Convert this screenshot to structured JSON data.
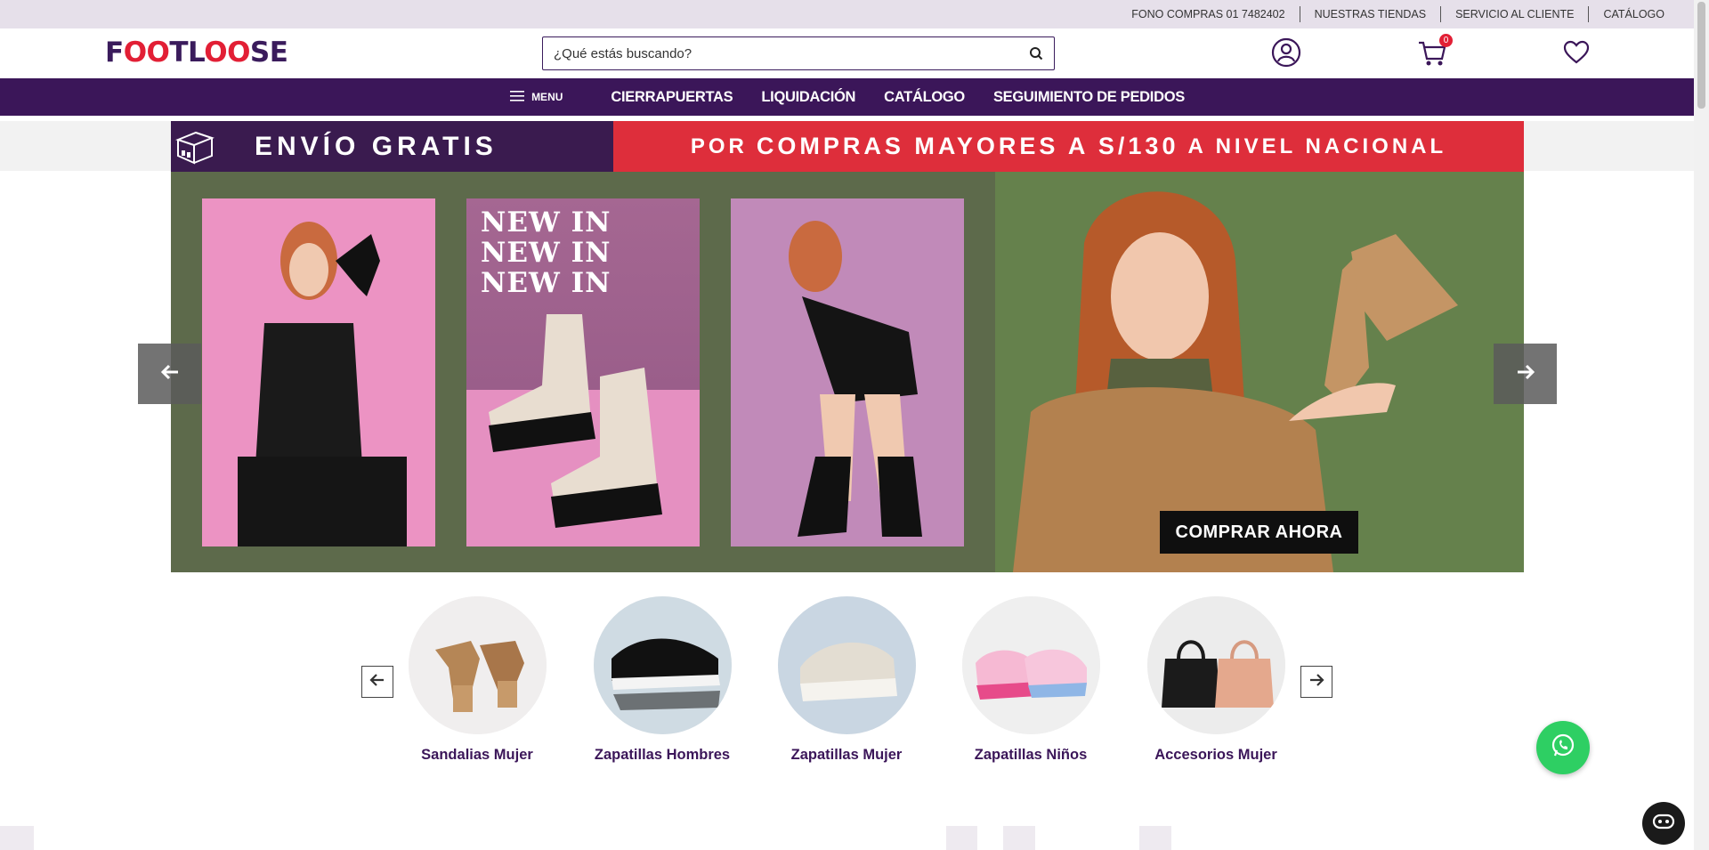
{
  "topbar": {
    "links": [
      "FONO COMPRAS 01 7482402",
      "NUESTRAS TIENDAS",
      "SERVICIO AL CLIENTE",
      "CATÁLOGO"
    ]
  },
  "header": {
    "logo_text": "FOOTLOOSE",
    "search_placeholder": "¿Qué estás buscando?",
    "cart_count": "0"
  },
  "nav": {
    "menu_label": "MENU",
    "links": [
      "CIERRAPUERTAS",
      "LIQUIDACIÓN",
      "CATÁLOGO",
      "SEGUIMIENTO DE PEDIDOS"
    ]
  },
  "promo": {
    "left_text": "ENVÍO GRATIS",
    "right_prefix": "POR",
    "right_bold": "COMPRAS MAYORES A S/130",
    "right_suffix": "A NIVEL NACIONAL"
  },
  "hero": {
    "panel_text": [
      "NEW IN",
      "NEW IN",
      "NEW IN"
    ],
    "cta_label": "COMPRAR AHORA"
  },
  "categories": [
    {
      "label": "Sandalias Mujer"
    },
    {
      "label": "Zapatillas Hombres"
    },
    {
      "label": "Zapatillas Mujer"
    },
    {
      "label": "Zapatillas Niños"
    },
    {
      "label": "Accesorios Mujer"
    }
  ],
  "colors": {
    "brand_purple": "#3b1659",
    "brand_red": "#e21f35",
    "whatsapp_green": "#2ecf63"
  }
}
